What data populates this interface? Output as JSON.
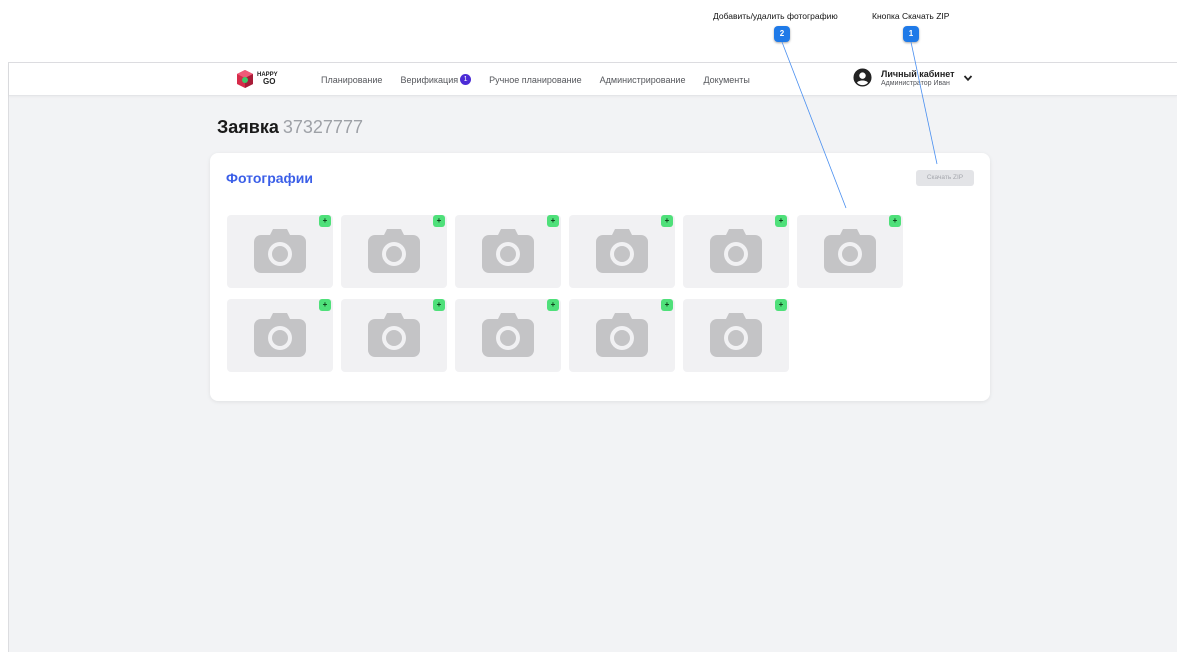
{
  "annotations": {
    "add_remove_photo": {
      "label": "Добавить/удалить фотографию",
      "badge": "2"
    },
    "download_zip": {
      "label": "Кнопка Скачать ZIP",
      "badge": "1"
    }
  },
  "header": {
    "logo_text_top": "HAPPY",
    "logo_text_bottom": "GO",
    "nav": [
      {
        "label": "Планирование"
      },
      {
        "label": "Верификация",
        "badge": "1"
      },
      {
        "label": "Ручное планирование"
      },
      {
        "label": "Администрирование"
      },
      {
        "label": "Документы"
      }
    ],
    "account": {
      "title": "Личный кабинет",
      "subtitle": "Администратор Иван"
    }
  },
  "page": {
    "title": "Заявка",
    "number": "37327777"
  },
  "photos_card": {
    "title": "Фотографии",
    "download_button": "Скачать ZIP",
    "photo_count": 11,
    "add_symbol": "+"
  },
  "colors": {
    "accent": "#3b5fe8",
    "badge": "#4b2bd6",
    "add_button": "#4fe07a",
    "callout": "#1f7ae8"
  }
}
